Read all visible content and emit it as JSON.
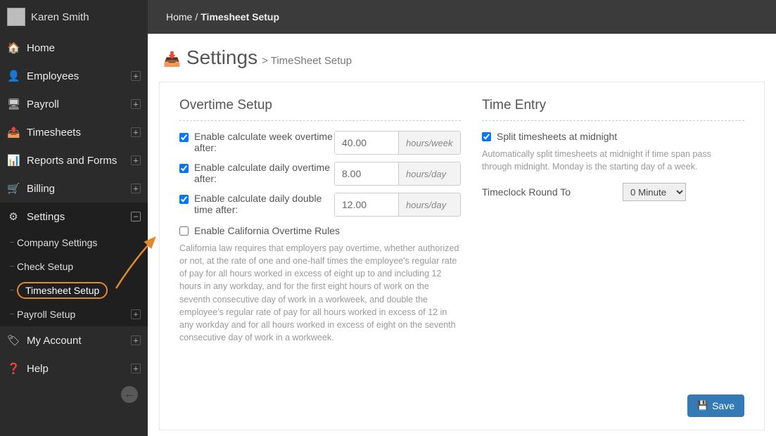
{
  "user": {
    "name": "Karen Smith"
  },
  "sidebar": {
    "items": [
      {
        "icon": "🏠",
        "label": "Home"
      },
      {
        "icon": "👤",
        "label": "Employees",
        "expandable": true
      },
      {
        "icon": "🖥",
        "label": "Payroll",
        "expandable": true
      },
      {
        "icon": "📤",
        "label": "Timesheets",
        "expandable": true
      },
      {
        "icon": "📊",
        "label": "Reports and Forms",
        "expandable": true
      },
      {
        "icon": "🛒",
        "label": "Billing",
        "expandable": true
      },
      {
        "icon": "⚙",
        "label": "Settings",
        "expandable": true
      }
    ],
    "settings_children": [
      {
        "label": "Company Settings"
      },
      {
        "label": "Check Setup"
      },
      {
        "label": "Timesheet Setup"
      },
      {
        "label": "Payroll Setup",
        "expandable": true
      }
    ],
    "after": [
      {
        "icon": "🏷",
        "label": "My Account",
        "expandable": true
      },
      {
        "icon": "❓",
        "label": "Help",
        "expandable": true
      }
    ]
  },
  "breadcrumb": {
    "home": "Home",
    "sep": "/",
    "current": "Timesheet Setup"
  },
  "page": {
    "title": "Settings",
    "sub": "> TimeSheet Setup"
  },
  "overtime": {
    "heading": "Overtime Setup",
    "rows": [
      {
        "label": "Enable calculate week overtime after:",
        "value": "40.00",
        "unit": "hours/week"
      },
      {
        "label": "Enable calculate daily overtime after:",
        "value": "8.00",
        "unit": "hours/day"
      },
      {
        "label": "Enable calculate daily double time after:",
        "value": "12.00",
        "unit": "hours/day"
      }
    ],
    "california_label": "Enable California Overtime Rules",
    "california_help": "California law requires that employers pay overtime, whether authorized or not, at the rate of one and one-half times the employee's regular rate of pay for all hours worked in excess of eight up to and including 12 hours in any workday, and for the first eight hours of work on the seventh consecutive day of work in a workweek, and double the employee's regular rate of pay for all hours worked in excess of 12 in any workday and for all hours worked in excess of eight on the seventh consecutive day of work in a workweek."
  },
  "timeentry": {
    "heading": "Time Entry",
    "split_label": "Split timesheets at midnight",
    "split_help": "Automatically split timesheets at midnight if time span pass through midnight. Monday is the starting day of a week.",
    "round_label": "Timeclock Round To",
    "round_value": "0 Minute"
  },
  "save_label": "Save"
}
